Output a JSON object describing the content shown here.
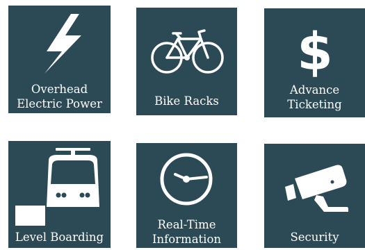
{
  "tiles": [
    {
      "icon": "lightning-bolt-icon",
      "lines": [
        "Overhead",
        "Electric Power"
      ]
    },
    {
      "icon": "bicycle-icon",
      "lines": [
        "Bike Racks"
      ]
    },
    {
      "icon": "dollar-sign-icon",
      "lines": [
        "Advance",
        "Ticketing"
      ]
    },
    {
      "icon": "tram-front-icon",
      "lines": [
        "Level Boarding"
      ]
    },
    {
      "icon": "clock-icon",
      "lines": [
        "Real-Time",
        "Information"
      ]
    },
    {
      "icon": "security-camera-icon",
      "lines": [
        "Security"
      ]
    }
  ],
  "colors": {
    "tile_bg": "#2b4a56",
    "text": "#ffffff"
  }
}
